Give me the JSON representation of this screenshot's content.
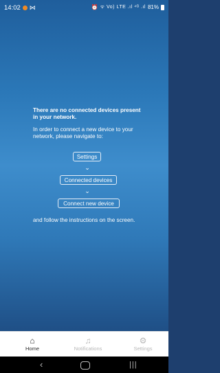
{
  "status_bar": {
    "time": "14:02",
    "signal_text": "ᯤ Vo) LTE .ıl ⁴ᴳ .ıl",
    "battery": "81%"
  },
  "message": {
    "headline": "There are no connected devices present in your network.",
    "instructions": "In order to connect a new device to your network, please navigate to:",
    "steps": [
      "Settings",
      "Connected devices",
      "Connect new device"
    ],
    "footer": "and follow the instructions on the screen."
  },
  "bottom_nav": {
    "home": "Home",
    "notifications": "Notifications",
    "settings": "Settings"
  },
  "colors": {
    "accent": "#2b78b8",
    "active_nav": "#2a2a2a",
    "inactive_nav": "#b7b7b7"
  }
}
